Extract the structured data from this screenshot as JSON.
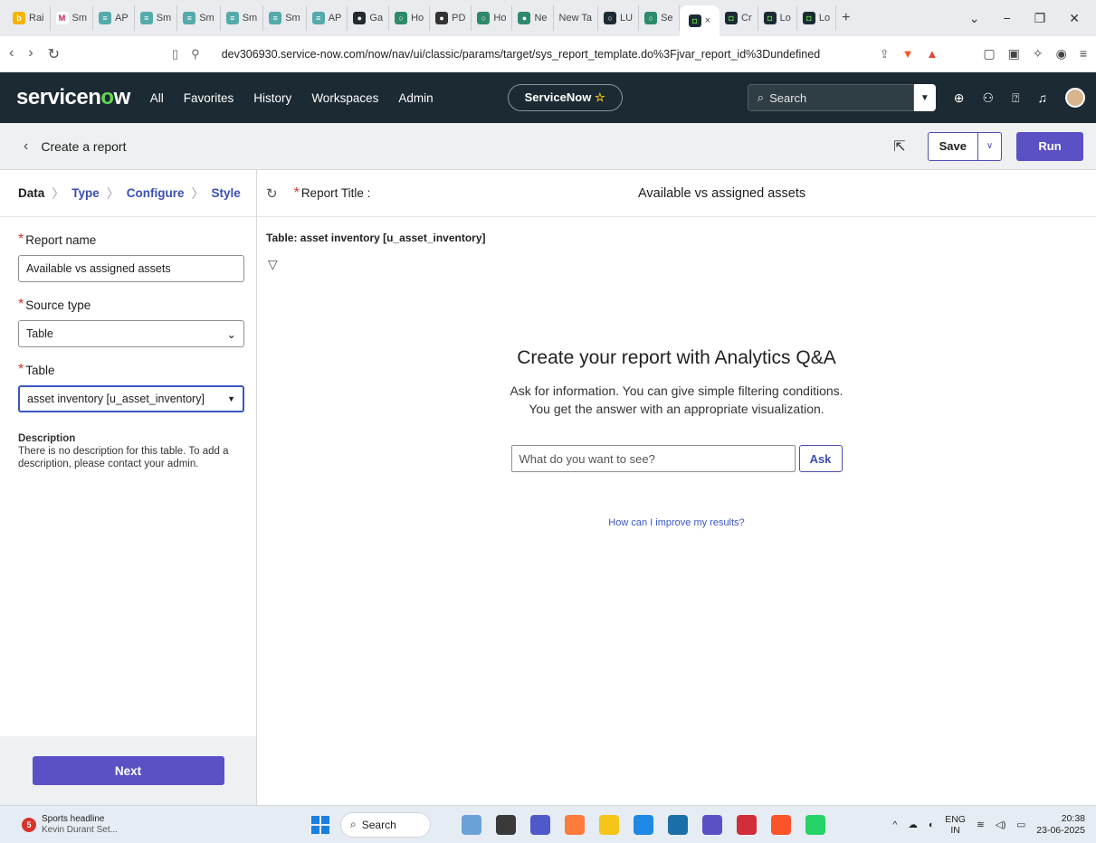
{
  "browser": {
    "tabs": [
      {
        "label": "Rai",
        "fav_color": "#f5b400",
        "fav_glyph": "b"
      },
      {
        "label": "Sm",
        "fav_color": "#ffffff",
        "fav_glyph": "M"
      },
      {
        "label": "AP",
        "fav_color": "#5aa",
        "fav_glyph": "≡"
      },
      {
        "label": "Sm",
        "fav_color": "#5aa",
        "fav_glyph": "≡"
      },
      {
        "label": "Sm",
        "fav_color": "#5aa",
        "fav_glyph": "≡"
      },
      {
        "label": "Sm",
        "fav_color": "#5aa",
        "fav_glyph": "≡"
      },
      {
        "label": "Sm",
        "fav_color": "#5aa",
        "fav_glyph": "≡"
      },
      {
        "label": "AP",
        "fav_color": "#5aa",
        "fav_glyph": "≡"
      },
      {
        "label": "Ga",
        "fav_color": "#24292e",
        "fav_glyph": "●"
      },
      {
        "label": "Ho",
        "fav_color": "#2d8a6a",
        "fav_glyph": "○"
      },
      {
        "label": "PD",
        "fav_color": "#333",
        "fav_glyph": "●"
      },
      {
        "label": "Ho",
        "fav_color": "#2d8a6a",
        "fav_glyph": "○"
      },
      {
        "label": "Ne",
        "fav_color": "#2d8a6a",
        "fav_glyph": "●"
      },
      {
        "label": "New Ta",
        "fav_color": "",
        "fav_glyph": ""
      },
      {
        "label": "LU",
        "fav_color": "#1b2a33",
        "fav_glyph": "○"
      },
      {
        "label": "Se",
        "fav_color": "#2d8a6a",
        "fav_glyph": "○"
      }
    ],
    "active_tab": {
      "label": "",
      "close": "×"
    },
    "tabs_after": [
      {
        "label": "Cr"
      },
      {
        "label": "Lo"
      },
      {
        "label": "Lo"
      }
    ],
    "new_tab": "+",
    "url": "dev306930.service-now.com/now/nav/ui/classic/params/target/sys_report_template.do%3Fjvar_report_id%3Dundefined"
  },
  "header": {
    "logo_pre": "servicen",
    "logo_o": "o",
    "logo_post": "w",
    "nav": [
      "All",
      "Favorites",
      "History",
      "Workspaces",
      "Admin"
    ],
    "instance": "ServiceNow",
    "search_placeholder": "Search"
  },
  "reportbar": {
    "title": "Create a report",
    "save": "Save",
    "run": "Run"
  },
  "steps": [
    "Data",
    "Type",
    "Configure",
    "Style"
  ],
  "form": {
    "report_name_label": "Report name",
    "report_name_value": "Available vs assigned assets",
    "source_type_label": "Source type",
    "source_type_value": "Table",
    "table_label": "Table",
    "table_value": "asset inventory [u_asset_inventory]",
    "description_title": "Description",
    "description_text": "There is no description for this table. To add a description, please contact your admin."
  },
  "next": "Next",
  "main": {
    "report_title_label": "Report Title :",
    "report_title_value": "Available vs assigned assets",
    "table_line": "Table: asset inventory [u_asset_inventory]",
    "qa_heading": "Create your report with Analytics Q&A",
    "qa_line1": "Ask for information. You can give simple filtering conditions.",
    "qa_line2": "You get the answer with an appropriate visualization.",
    "qa_placeholder": "What do you want to see?",
    "ask": "Ask",
    "improve_link": "How can I improve my results?"
  },
  "taskbar": {
    "news_title": "Sports headline",
    "news_sub": "Kevin Durant Set...",
    "news_badge": "5",
    "search": "Search",
    "lang1": "ENG",
    "lang2": "IN",
    "time": "20:38",
    "date": "23-06-2025",
    "apps": [
      "#6aa2d8",
      "#3a3a3a",
      "#5059c9",
      "#ff7a3d",
      "#f5c518",
      "#1e88e5",
      "#1b6fa8",
      "#5b51c4",
      "#d12e3a",
      "#fb542b",
      "#25d366"
    ]
  }
}
